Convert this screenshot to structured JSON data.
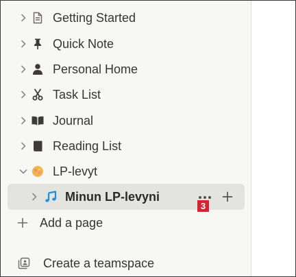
{
  "sidebar": {
    "pages": [
      {
        "label": "Getting Started",
        "icon": "document-icon"
      },
      {
        "label": "Quick Note",
        "icon": "pin-icon"
      },
      {
        "label": "Personal Home",
        "icon": "person-icon"
      },
      {
        "label": "Task List",
        "icon": "scissors-icon"
      },
      {
        "label": "Journal",
        "icon": "open-book-icon"
      },
      {
        "label": "Reading List",
        "icon": "book-icon"
      },
      {
        "label": "LP-levyt",
        "icon": "emoji-icon",
        "expanded": true
      }
    ],
    "subpage": {
      "label": "Minun LP-levyni",
      "icon": "music-note-icon",
      "more_icon": "more-dots-icon",
      "add_icon": "plus-icon",
      "badge": "3"
    },
    "add_page": {
      "label": "Add a page",
      "icon": "plus-icon"
    },
    "create_teamspace": {
      "label": "Create a teamspace",
      "icon": "teamspace-icon"
    }
  },
  "colors": {
    "sidebar_bg": "#f7f7f5",
    "selected_bg": "#e3e3e0",
    "text": "#37352f",
    "icon_gray": "#8e8b86",
    "music_blue": "#1f8fd6",
    "badge_red": "#d5232f"
  }
}
